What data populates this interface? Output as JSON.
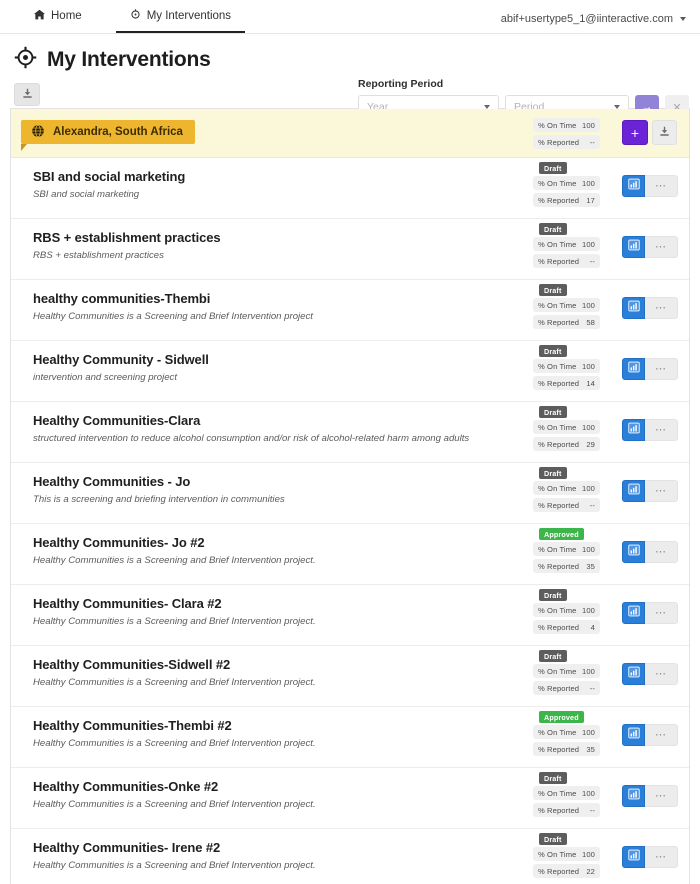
{
  "topnav": {
    "items": [
      {
        "label": "Home",
        "icon": "home-icon",
        "active": false
      },
      {
        "label": "My Interventions",
        "icon": "target-icon",
        "active": true
      }
    ],
    "account": {
      "email": "abif+usertype5_1@iinteractive.com",
      "caret_icon": "chevron-down-icon"
    }
  },
  "header": {
    "title": "My Interventions",
    "title_icon": "crosshair-target-icon",
    "download_icon": "download-icon",
    "reporting_period": {
      "label": "Reporting Period",
      "year": {
        "value": "",
        "placeholder": "Year",
        "caret_icon": "chevron-down-icon"
      },
      "period": {
        "value": "",
        "placeholder": "Period",
        "caret_icon": "chevron-down-icon"
      },
      "go_label": "→",
      "clear_label": "✕"
    }
  },
  "location_band": {
    "name": "Alexandra, South Africa",
    "globe_icon": "globe-icon",
    "stats": [
      {
        "key": "% On Time",
        "value": "100"
      },
      {
        "key": "% Reported",
        "value": "--"
      }
    ],
    "add_label": "+",
    "add_icon": "plus-icon",
    "download_icon": "download-icon",
    "accent_color": "#eeb52e",
    "band_color": "#fbf8da"
  },
  "stat_keys": {
    "on_time": "% On Time",
    "reported": "% Reported"
  },
  "action_icons": {
    "chart": "bar-chart-icon",
    "more": "ellipsis-icon"
  },
  "interventions": [
    {
      "title": "SBI and social marketing",
      "description": "SBI and social marketing",
      "status": "Draft",
      "on_time": "100",
      "reported": "17"
    },
    {
      "title": "RBS + establishment practices",
      "description": "RBS + establishment practices",
      "status": "Draft",
      "on_time": "100",
      "reported": "--"
    },
    {
      "title": "healthy communities-Thembi",
      "description": "Healthy Communities is a Screening and Brief Intervention project",
      "status": "Draft",
      "on_time": "100",
      "reported": "58"
    },
    {
      "title": "Healthy Community - Sidwell",
      "description": "intervention and screening project",
      "status": "Draft",
      "on_time": "100",
      "reported": "14"
    },
    {
      "title": "Healthy Communities-Clara",
      "description": "structured intervention to reduce alcohol consumption and/or risk of alcohol-related harm among adults",
      "status": "Draft",
      "on_time": "100",
      "reported": "29"
    },
    {
      "title": "Healthy Communities - Jo",
      "description": "This is a screening and briefing intervention in communities",
      "status": "Draft",
      "on_time": "100",
      "reported": "--"
    },
    {
      "title": "Healthy Communities- Jo #2",
      "description": "Healthy Communities is a Screening and Brief Intervention project.",
      "status": "Approved",
      "on_time": "100",
      "reported": "35"
    },
    {
      "title": "Healthy Communities- Clara #2",
      "description": "Healthy Communities is a Screening and Brief Intervention project.",
      "status": "Draft",
      "on_time": "100",
      "reported": "4"
    },
    {
      "title": "Healthy Communities-Sidwell #2",
      "description": "Healthy Communities is a Screening and Brief Intervention project.",
      "status": "Draft",
      "on_time": "100",
      "reported": "--"
    },
    {
      "title": "Healthy Communities-Thembi #2",
      "description": "Healthy Communities is a Screening and Brief Intervention project.",
      "status": "Approved",
      "on_time": "100",
      "reported": "35"
    },
    {
      "title": "Healthy Communities-Onke #2",
      "description": "Healthy Communities is a Screening and Brief Intervention project.",
      "status": "Draft",
      "on_time": "100",
      "reported": "--"
    },
    {
      "title": "Healthy Communities- Irene #2",
      "description": "Healthy Communities is a Screening and Brief Intervention project.",
      "status": "Draft",
      "on_time": "100",
      "reported": "22"
    }
  ],
  "colors": {
    "purple_accent": "#6c22d6",
    "go_button": "#9184d6",
    "blue_action": "#2a7fdb",
    "draft_badge": "#5d5d5d",
    "approved_badge": "#3cb54a",
    "band_yellow": "#fbf8da",
    "tag_yellow": "#eeb52e"
  }
}
